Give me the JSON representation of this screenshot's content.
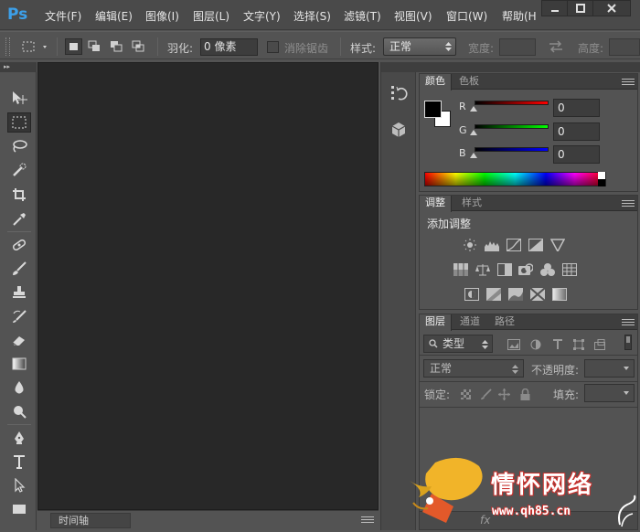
{
  "app": {
    "logo": "Ps"
  },
  "menu": [
    "文件(F)",
    "编辑(E)",
    "图像(I)",
    "图层(L)",
    "文字(Y)",
    "选择(S)",
    "滤镜(T)",
    "视图(V)",
    "窗口(W)",
    "帮助(H"
  ],
  "options": {
    "feather_label": "羽化:",
    "feather_value": "0 像素",
    "antialias_label": "消除锯齿",
    "style_label": "样式:",
    "style_value": "正常",
    "width_label": "宽度:",
    "height_label": "高度:"
  },
  "tools": [
    "move-tool",
    "rect-marquee-tool",
    "lasso-tool",
    "quick-select-tool",
    "crop-tool",
    "eyedropper-tool",
    "healing-brush-tool",
    "brush-tool",
    "clone-stamp-tool",
    "history-brush-tool",
    "eraser-tool",
    "gradient-tool",
    "blur-tool",
    "dodge-tool",
    "pen-tool",
    "type-tool",
    "path-select-tool",
    "rectangle-tool"
  ],
  "color_panel": {
    "tabs": [
      "颜色",
      "色板"
    ],
    "r_label": "R",
    "g_label": "G",
    "b_label": "B",
    "r_value": "0",
    "g_value": "0",
    "b_value": "0",
    "foreground": "#000000",
    "background": "#ffffff"
  },
  "adjust_panel": {
    "tabs": [
      "调整",
      "样式"
    ],
    "heading": "添加调整"
  },
  "layers_panel": {
    "tabs": [
      "图层",
      "通道",
      "路径"
    ],
    "filter_label": "类型",
    "blend_mode": "正常",
    "opacity_label": "不透明度:",
    "lock_label": "锁定:",
    "fill_label": "填充:",
    "fx_label": "fx"
  },
  "timeline": {
    "tab_label": "时间轴"
  },
  "watermark": {
    "title": "情怀网络",
    "url": "www.qh85.cn"
  }
}
